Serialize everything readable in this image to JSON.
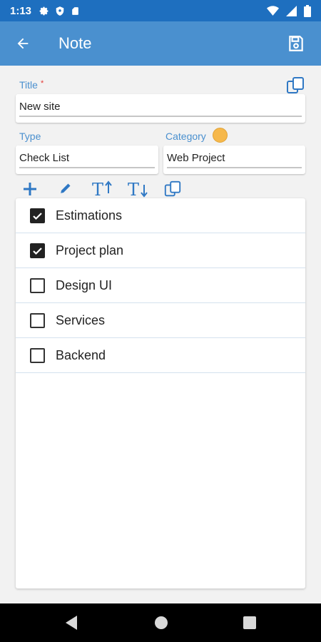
{
  "status_bar": {
    "time": "1:13",
    "icons": [
      "gear-icon",
      "shield-icon",
      "sd-card-icon",
      "wifi-icon",
      "signal-icon",
      "battery-icon"
    ]
  },
  "app_bar": {
    "title": "Note",
    "back_icon": "arrow-left-icon",
    "save_icon": "save-icon"
  },
  "form": {
    "title_label": "Title",
    "required_marker": "*",
    "title_value": "New site",
    "type_label": "Type",
    "type_value": "Check List",
    "category_label": "Category",
    "category_value": "Web Project",
    "category_color": "#f6b84b"
  },
  "toolbar": {
    "icons": [
      "plus-icon",
      "pencil-icon",
      "text-size-increase-icon",
      "text-size-decrease-icon",
      "copy-icon"
    ]
  },
  "checklist": {
    "items": [
      {
        "label": "Estimations",
        "checked": true
      },
      {
        "label": "Project plan",
        "checked": true
      },
      {
        "label": "Design UI",
        "checked": false
      },
      {
        "label": "Services",
        "checked": false
      },
      {
        "label": "Backend",
        "checked": false
      }
    ]
  },
  "colors": {
    "status_bar": "#1e6fbf",
    "app_bar": "#4a90cf",
    "accent": "#2f78c4",
    "background": "#f2f2f2"
  }
}
